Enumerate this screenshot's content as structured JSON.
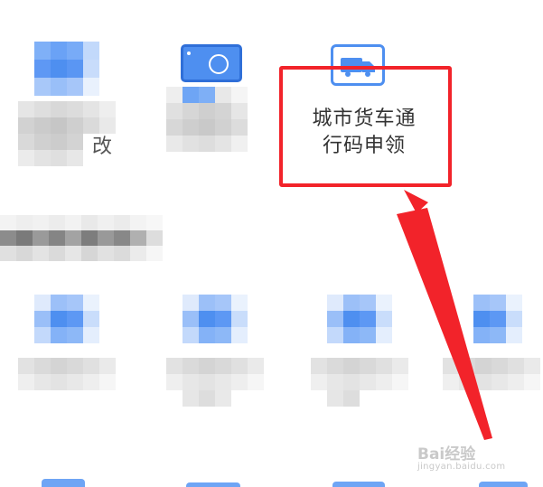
{
  "tile_highlighted": {
    "label_line1": "城市货车通",
    "label_line2": "行码申领",
    "icon": "truck-icon",
    "accent": "#4e8ff0"
  },
  "tile_top2": {
    "partial_label": "改"
  },
  "annotation": {
    "box_color": "#f2232a",
    "arrow_color": "#f2232a"
  },
  "watermark": {
    "text": "Bai经验",
    "url": "jingyan.baidu.com"
  }
}
